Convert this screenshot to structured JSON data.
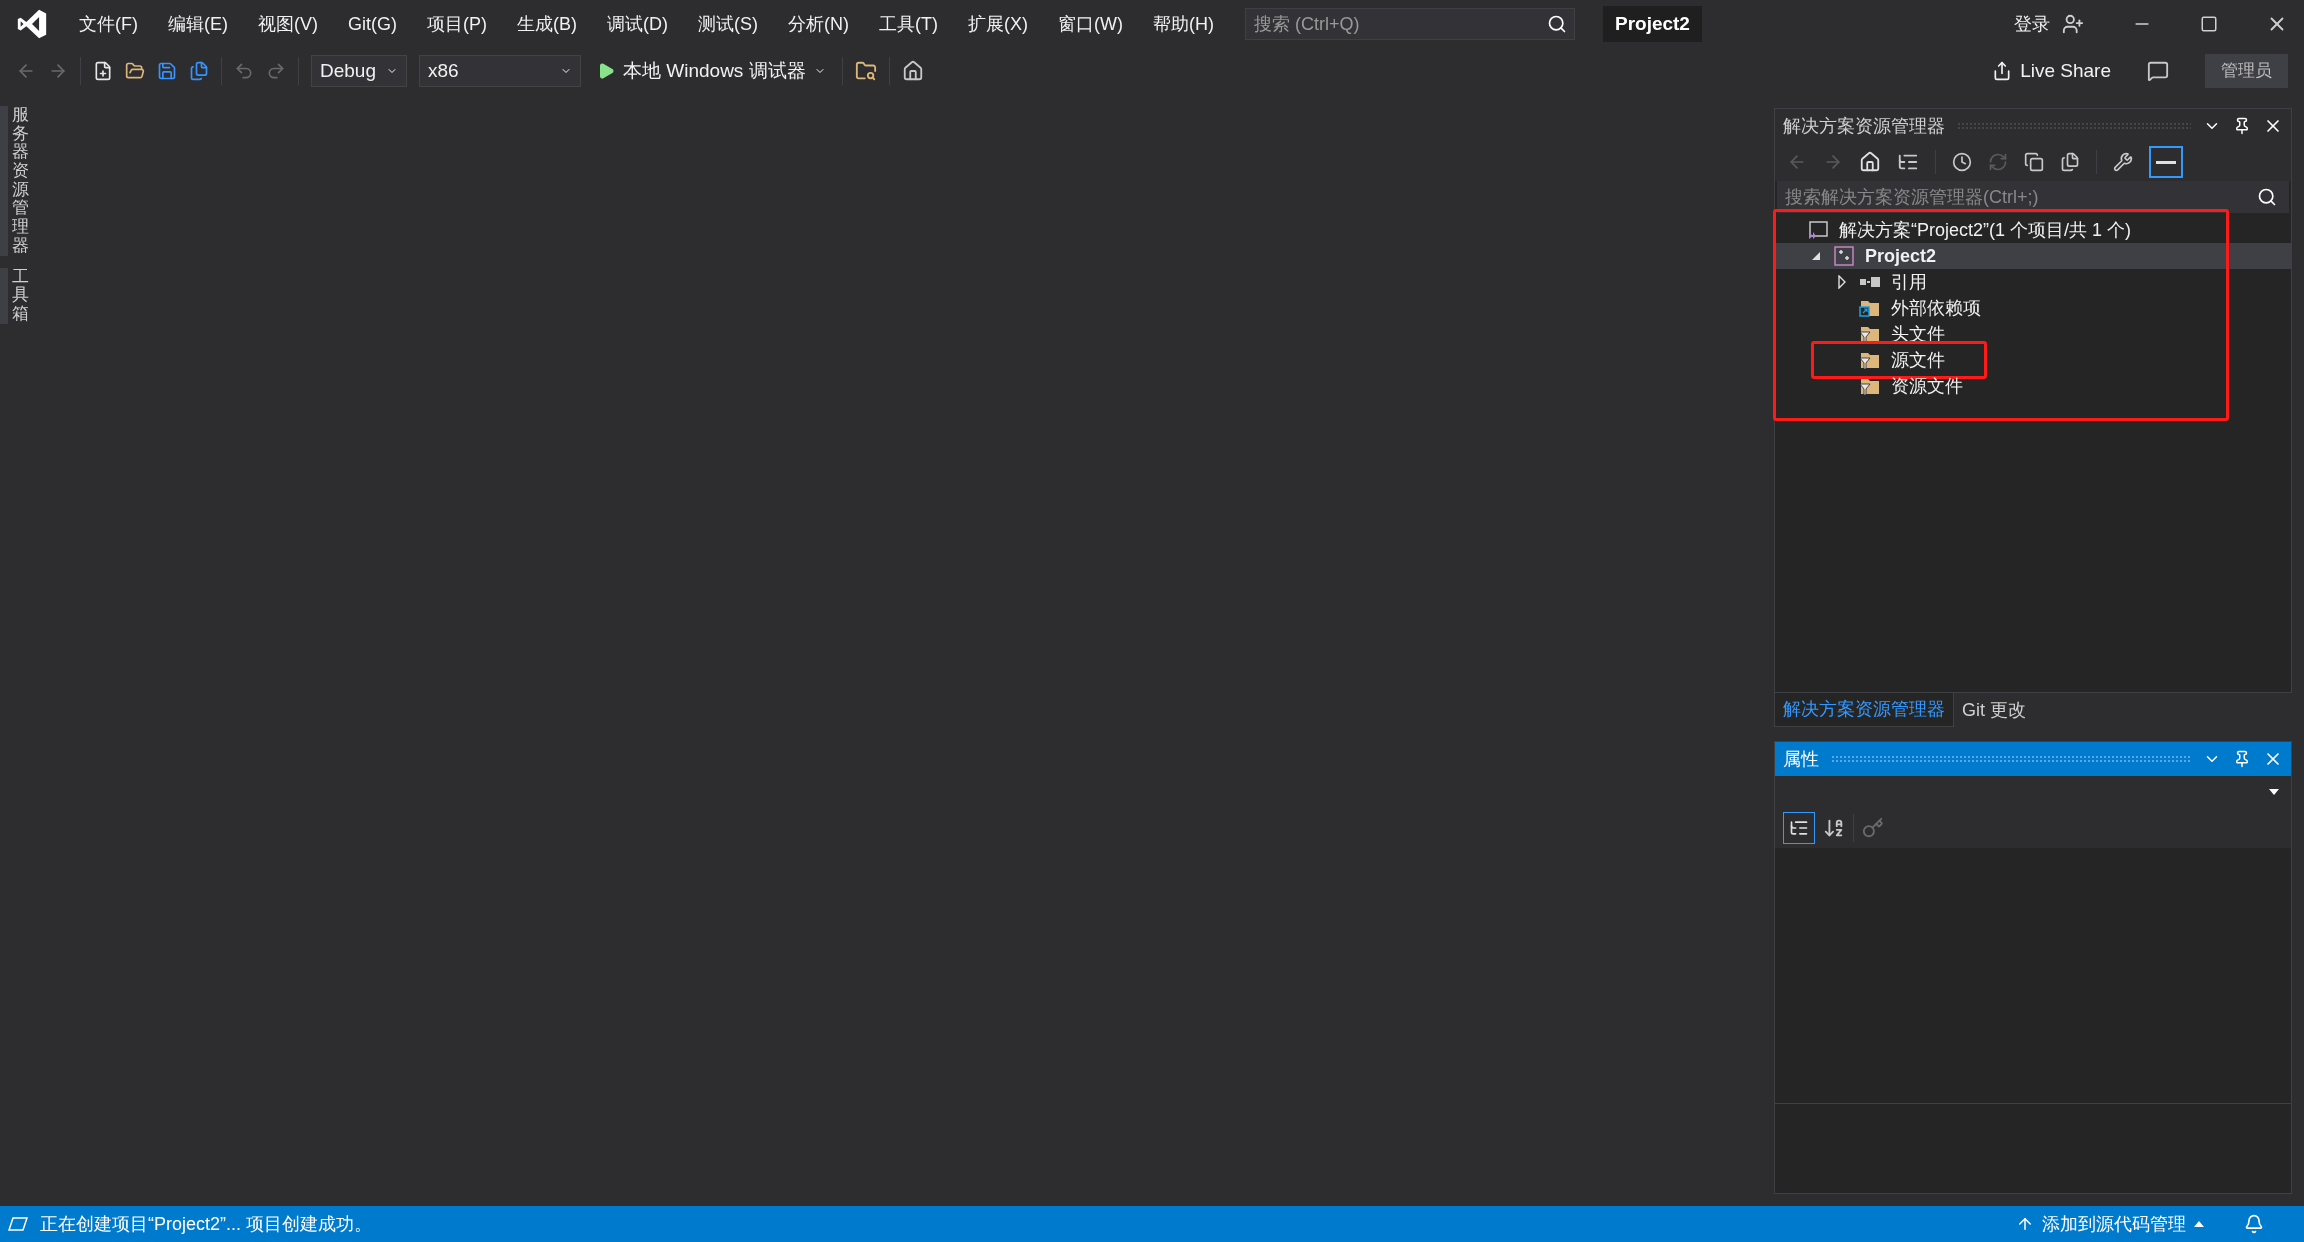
{
  "title_bar": {
    "menu": [
      "文件(F)",
      "编辑(E)",
      "视图(V)",
      "Git(G)",
      "项目(P)",
      "生成(B)",
      "调试(D)",
      "测试(S)",
      "分析(N)",
      "工具(T)",
      "扩展(X)",
      "窗口(W)",
      "帮助(H)"
    ],
    "search": {
      "placeholder": "搜索 (Ctrl+Q)"
    },
    "project_name": "Project2",
    "sign_in": "登录"
  },
  "toolbar": {
    "configuration": "Debug",
    "platform": "x86",
    "run_label": "本地 Windows 调试器",
    "live_share": "Live Share",
    "admin_badge": "管理员"
  },
  "side_tabs": [
    "服务器资源管理器",
    "工具箱"
  ],
  "solution_explorer": {
    "title": "解决方案资源管理器",
    "search": {
      "placeholder": "搜索解决方案资源管理器(Ctrl+;)"
    },
    "highlighted": true,
    "tree": [
      {
        "kind": "solution",
        "label": "解决方案“Project2”(1 个项目/共 1 个)",
        "selected": false,
        "highlighted": false,
        "children": [
          {
            "kind": "project",
            "label": "Project2",
            "selected": true,
            "highlighted": false,
            "expanded": true,
            "children": [
              {
                "kind": "references",
                "label": "引用",
                "selected": false,
                "highlighted": false,
                "expanded": false
              },
              {
                "kind": "external",
                "label": "外部依赖项",
                "selected": false,
                "highlighted": false
              },
              {
                "kind": "filter",
                "label": "头文件",
                "selected": false,
                "highlighted": false
              },
              {
                "kind": "filter",
                "label": "源文件",
                "selected": false,
                "highlighted": true
              },
              {
                "kind": "filter",
                "label": "资源文件",
                "selected": false,
                "highlighted": false
              }
            ]
          }
        ]
      }
    ]
  },
  "panel_tabs": [
    {
      "label": "解决方案资源管理器",
      "selected": true
    },
    {
      "label": "Git 更改",
      "selected": false
    }
  ],
  "properties": {
    "title": "属性",
    "active": true
  },
  "status_bar": {
    "message": "正在创建项目“Project2”... 项目创建成功。",
    "source_control": "添加到源代码管理"
  }
}
